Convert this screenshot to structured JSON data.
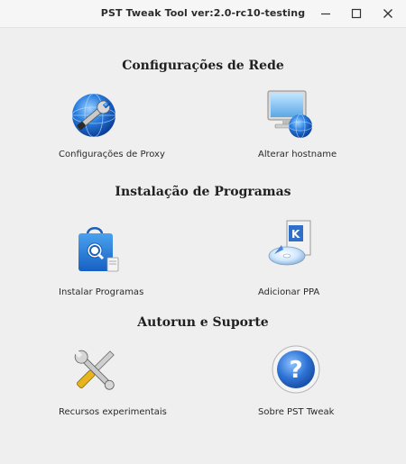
{
  "window": {
    "title": "PST Tweak Tool  ver:2.0-rc10-testing",
    "controls": [
      "minimize-icon",
      "maximize-icon",
      "close-icon"
    ]
  },
  "sections": {
    "network": {
      "title": "Configurações de Rede",
      "items": {
        "proxy": {
          "label": "Configurações de Proxy",
          "icon": "globe-wrench-icon"
        },
        "hostname": {
          "label": "Alterar hostname",
          "icon": "computer-globe-icon"
        }
      }
    },
    "programs": {
      "title": "Instalação de Programas",
      "items": {
        "install": {
          "label": "Instalar Programas",
          "icon": "software-bag-icon"
        },
        "ppa": {
          "label": "Adicionar PPA",
          "icon": "package-disc-icon"
        }
      }
    },
    "support": {
      "title": "Autorun e Suporte",
      "items": {
        "experimental": {
          "label": "Recursos experimentais",
          "icon": "tools-icon"
        },
        "about": {
          "label": "Sobre PST Tweak",
          "icon": "help-icon"
        }
      }
    }
  },
  "colors": {
    "background": "#efefef",
    "titlebar": "#f6f6f6",
    "globe_blue": "#1d6fd0",
    "help_blue": "#2f74d6",
    "wrench_yellow": "#e6b51e"
  }
}
